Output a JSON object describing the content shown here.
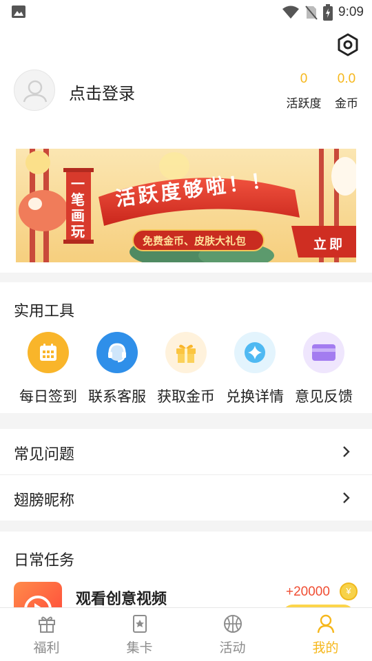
{
  "status_bar": {
    "time": "9:09"
  },
  "profile": {
    "login_text": "点击登录",
    "stats": [
      {
        "value": "0",
        "label": "活跃度"
      },
      {
        "value": "0.0",
        "label": "金币"
      }
    ]
  },
  "banner": {
    "side_text": "一笔画玩",
    "headline": "活跃度够啦！！",
    "sub": "免费金币、皮肤大礼包",
    "cta": "立即"
  },
  "tools": {
    "title": "实用工具",
    "items": [
      {
        "label": "每日签到",
        "icon": "calendar-icon",
        "color": "#f9b52a"
      },
      {
        "label": "联系客服",
        "icon": "headset-icon",
        "color": "#2f8fe9"
      },
      {
        "label": "获取金币",
        "icon": "gift-icon",
        "color": "#f9c33a"
      },
      {
        "label": "兑换详情",
        "icon": "diamond-icon",
        "color": "#5cc0f5"
      },
      {
        "label": "意见反馈",
        "icon": "card-icon",
        "color": "#a681f0"
      }
    ]
  },
  "menu": [
    {
      "label": "常见问题"
    },
    {
      "label": "翅膀昵称"
    }
  ],
  "tasks": {
    "title": "日常任务",
    "items": [
      {
        "name": "观看创意视频",
        "reward": "+20000",
        "coin_symbol": "¥"
      }
    ]
  },
  "tabbar": [
    {
      "label": "福利",
      "icon": "gift-tab-icon",
      "active": false
    },
    {
      "label": "集卡",
      "icon": "card-collection-icon",
      "active": false
    },
    {
      "label": "活动",
      "icon": "basketball-icon",
      "active": false
    },
    {
      "label": "我的",
      "icon": "user-icon",
      "active": true
    }
  ],
  "colors": {
    "accent": "#f6b71b",
    "reward": "#f04d32"
  }
}
